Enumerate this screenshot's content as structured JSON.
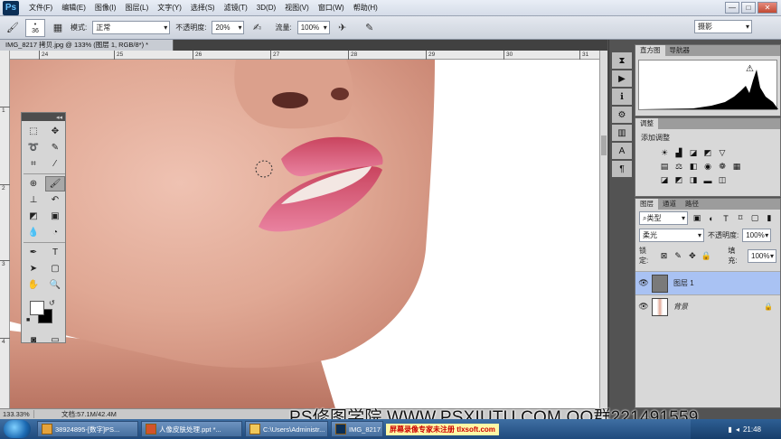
{
  "app": {
    "logo": "Ps"
  },
  "menubar": [
    "文件(F)",
    "编辑(E)",
    "图像(I)",
    "图层(L)",
    "文字(Y)",
    "选择(S)",
    "滤镜(T)",
    "3D(D)",
    "视图(V)",
    "窗口(W)",
    "帮助(H)"
  ],
  "window_controls": {
    "minimize": "—",
    "maximize": "□",
    "close": "✕"
  },
  "options": {
    "brush_size": "36",
    "mode_label": "模式:",
    "mode_value": "正常",
    "opacity_label": "不透明度:",
    "opacity_value": "20%",
    "flow_label": "流量:",
    "flow_value": "100%",
    "workspace": "摄影"
  },
  "document": {
    "tab_title": "IMG_8217 拷贝.jpg @ 133% (图层 1, RGB/8*) *"
  },
  "rulers": {
    "top": [
      "24",
      "25",
      "26",
      "27",
      "28",
      "29",
      "30",
      "31"
    ],
    "left": [
      "1",
      "2",
      "3",
      "4"
    ]
  },
  "panels": {
    "histogram": {
      "tabs": [
        "直方图",
        "导航器"
      ]
    },
    "adjustments": {
      "tab": "调整",
      "title": "添加调整"
    },
    "layers": {
      "tabs": [
        "图层",
        "通道",
        "路径"
      ],
      "filter_kind": "类型",
      "blend_mode": "柔光",
      "opacity_label": "不透明度:",
      "opacity_value": "100%",
      "lock_label": "锁定:",
      "fill_label": "填充:",
      "fill_value": "100%",
      "items": [
        {
          "name": "图层 1",
          "selected": true
        },
        {
          "name": "背景",
          "selected": false,
          "locked": true
        }
      ]
    }
  },
  "status": {
    "zoom": "133.33%",
    "doc_info": "文档:57.1M/42.4M"
  },
  "watermark": "PS修图学院 WWW.PSXIUTU.COM QQ群221491559",
  "taskbar": {
    "tasks": [
      "38924895-[数字]PS...",
      "人像皮肤处理.ppt *...",
      "C:\\Users\\Administr...",
      "IMG_8217"
    ],
    "banner": "屏幕录像专家未注册 tlxsoft.com",
    "time": "21:48"
  },
  "colors": {
    "accent_selected_layer": "#a9c2f3",
    "lip": "#d2566e",
    "skin": "#e9b4a3"
  }
}
